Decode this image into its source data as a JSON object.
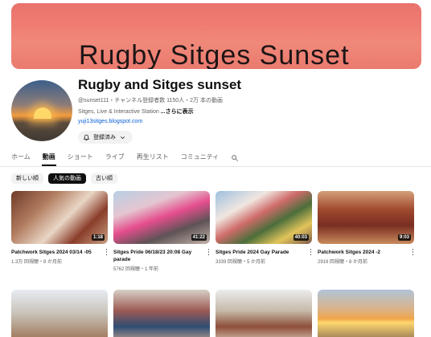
{
  "banner": {
    "text": "Rugby  Sitges  Sunset"
  },
  "channel": {
    "title": "Rugby and Sitges sunset",
    "meta": "@sunset111・チャンネル登録者数 1150人・2万 本の動画",
    "description": "Sitges, Live & Interactive Station ",
    "more": "...さらに表示",
    "link": "yuji13sitges.blogspot.com",
    "subscribe_label": "登録済み"
  },
  "tabs": [
    "ホーム",
    "動画",
    "ショート",
    "ライブ",
    "再生リスト",
    "コミュニティ"
  ],
  "active_tab": "動画",
  "chips": [
    "新しい順",
    "人気の動画",
    "古い順"
  ],
  "active_chip": "人気の動画",
  "videos": [
    {
      "title": "Patchwork Sitges 2024 03/14 -05",
      "meta": "1.3万 回視聴・8 か月前",
      "duration": "1:18"
    },
    {
      "title": "Sitges Pride 06/18/23 20:08 Gay parade",
      "meta": "5762 回視聴・1 年前",
      "duration": "41:22"
    },
    {
      "title": "Sitges Pride 2024 Gay Parade",
      "meta": "3339 回視聴・5 か月前",
      "duration": "40:03"
    },
    {
      "title": "Patchwork Sitges 2024 -2",
      "meta": "2919 回視聴・8 か月前",
      "duration": "9:03"
    }
  ],
  "colors": {
    "accent": "#0f0f0f",
    "link": "#065fd4",
    "banner": "#ef7d73"
  }
}
